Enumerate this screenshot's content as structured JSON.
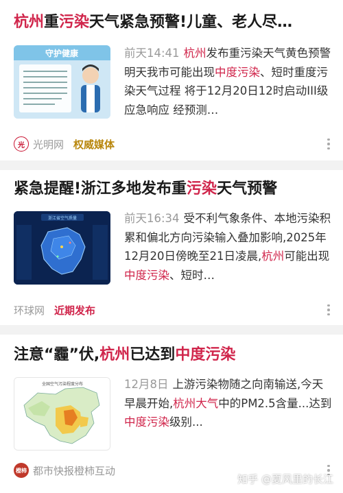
{
  "colors": {
    "highlight": "#d0254b",
    "tag_gold": "#b8860b",
    "meta_gray": "#999999"
  },
  "articles": [
    {
      "title_parts": [
        "杭州",
        "重",
        "污染",
        "天气紧急预警!儿童、老人尽…"
      ],
      "thumb_title": "守护健康",
      "time": "前天14:41",
      "snippet_parts": [
        "杭州",
        "发布重污染天气黄色预警 明天我市可能出现",
        "中度污染",
        "、短时重度污染天气过程 将于12月20日12时启动III级应急响应 经预测…"
      ],
      "source": "光明网",
      "source_icon": "guangming-logo-icon",
      "tag": "权威媒体"
    },
    {
      "title_parts": [
        "紧急提醒!浙江多地发布重",
        "污染",
        "天气预警"
      ],
      "thumb_title": "浙江省空气质量",
      "time": "前天16:34",
      "snippet_parts": [
        "受不利气象条件、本地污染积累和偏北方向污染输入叠加影响,2025年12月20日傍晚至21日凌晨,",
        "杭州",
        "可能出现",
        "中度污染",
        "、短时…"
      ],
      "source": "环球网",
      "tag": "近期发布"
    },
    {
      "title_parts": [
        "注意“霾”伏,",
        "杭州",
        "已达到",
        "中度污染"
      ],
      "thumb_title": "全国空气污染程度分布",
      "time": "12月8日",
      "snippet_parts": [
        "上游污染物随之向南输送,今天早晨开始,",
        "杭州大气",
        "中的PM2.5含量...达到",
        "中度污染",
        "级别..."
      ],
      "source": "都市快报橙柿互动",
      "source_icon_text": "橙柿"
    }
  ],
  "watermark": "知乎 @夏风里的长江"
}
